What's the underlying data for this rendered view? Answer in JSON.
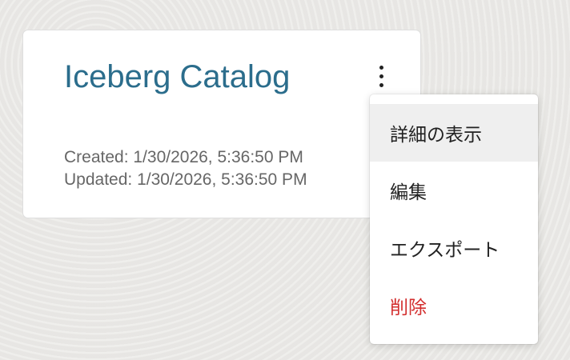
{
  "card": {
    "title": "Iceberg Catalog",
    "created": "Created: 1/30/2026, 5:36:50 PM",
    "updated": "Updated: 1/30/2026, 5:36:50 PM",
    "more_icon": "kebab-vertical-icon"
  },
  "menu": {
    "items": [
      {
        "label": "詳細の表示"
      },
      {
        "label": "編集"
      },
      {
        "label": "エクスポート"
      },
      {
        "label": "削除"
      }
    ]
  },
  "colors": {
    "title": "#2b6d8c",
    "text": "#222222",
    "meta": "#666666",
    "danger": "#d32f2f",
    "active": "#efefef"
  }
}
